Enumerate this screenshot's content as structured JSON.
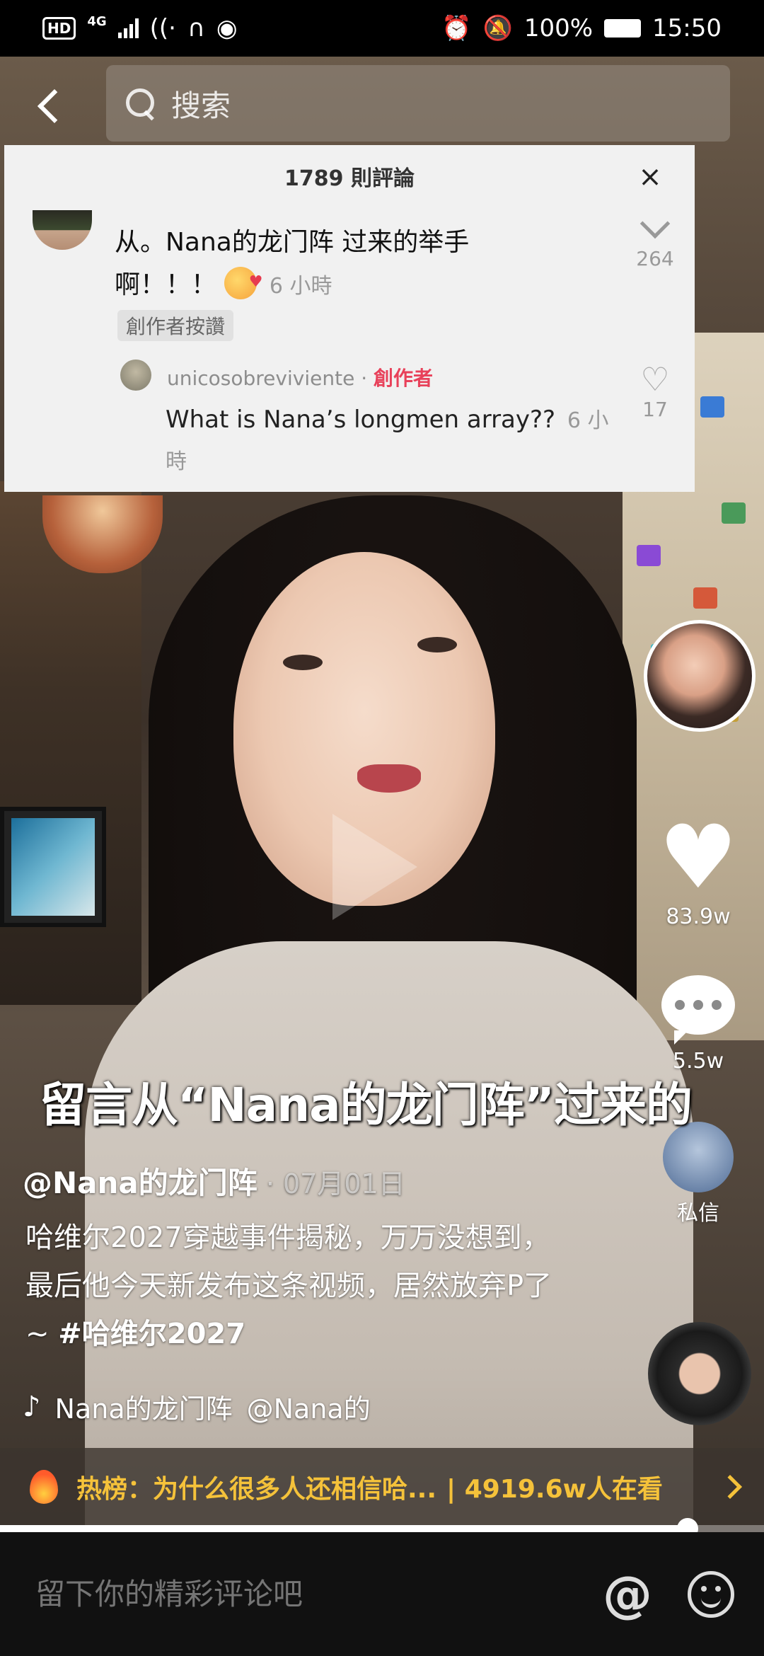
{
  "status_bar": {
    "hd": "HD",
    "network": "4G",
    "battery": "100%",
    "time": "15:50"
  },
  "search": {
    "placeholder": "搜索"
  },
  "comment_card": {
    "title": "1789 則評論",
    "close": "×",
    "comment_text": "从。Nana的龙门阵 过来的举手啊！！！",
    "comment_time": "6 小時",
    "creator_liked": "創作者按讚",
    "dislike_count": "264",
    "reply_user": "unicosobreviviente ·",
    "reply_creator_tag": "創作者",
    "reply_text": "What is Nana’s longmen array??",
    "reply_time": "6 小時",
    "reply_likes": "17"
  },
  "actions": {
    "likes": "83.9w",
    "comments": "5.5w",
    "dm_label": "私信"
  },
  "video": {
    "subtitle": "留言从“Nana的龙门阵”过来的",
    "author": "@Nana的龙门阵",
    "date": " · 07月01日",
    "description": "哈维尔2027穿越事件揭秘，万万没想到，最后他今天新发布这条视频，居然放弃P了~ ",
    "hashtag": "#哈维尔2027",
    "music_title": "Nana的龙门阵",
    "music_author": "@Nana的",
    "progress": 0.9
  },
  "hot": {
    "label": "热榜：为什么很多人还相信哈...",
    "watching": "| 4919.6w人在看"
  },
  "bottom": {
    "input_placeholder": "留下你的精彩评论吧"
  },
  "icons": {
    "back": "back-arrow-icon",
    "search": "search-icon",
    "like": "heart-icon",
    "comment": "comment-bubble-icon",
    "at": "at-icon",
    "emoji": "smile-icon",
    "music": "music-note-icon",
    "fire": "fire-icon"
  },
  "colors": {
    "hot_text": "#f5c23a",
    "creator_tag": "#e8415a"
  }
}
